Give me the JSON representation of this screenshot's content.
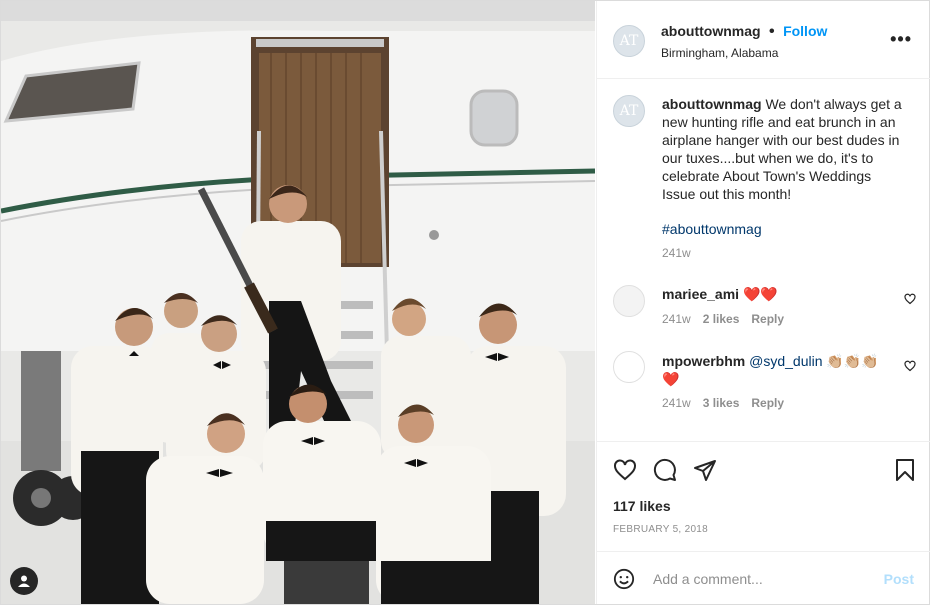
{
  "post": {
    "author": "abouttownmag",
    "follow_label": "Follow",
    "location": "Birmingham, Alabama",
    "more_icon": "more-horizontal-icon",
    "avatar_text": "AT",
    "caption": "We don't always get a new hunting rifle and eat brunch in an airplane hanger with our best dudes in our tuxes....but when we do, it's to celebrate About Town's Weddings Issue out this month!",
    "hashtag": "#abouttownmag",
    "caption_time": "241w",
    "likes": "117 likes",
    "date": "FEBRUARY 5, 2018",
    "add_comment_placeholder": "Add a comment...",
    "post_label": "Post"
  },
  "comments": [
    {
      "user": "mariee_ami",
      "text": "❤️❤️",
      "time": "241w",
      "likes": "2 likes",
      "reply": "Reply"
    },
    {
      "user": "mpowerbhm",
      "text": "@syd_dulin 👏🏼👏🏼👏🏼 ❤️",
      "mention": "@syd_dulin",
      "time": "241w",
      "likes": "3 likes",
      "reply": "Reply"
    }
  ],
  "colors": {
    "accent": "#0095f6",
    "heart": "#ed4956",
    "text": "#262626",
    "muted": "#8e8e8e"
  }
}
